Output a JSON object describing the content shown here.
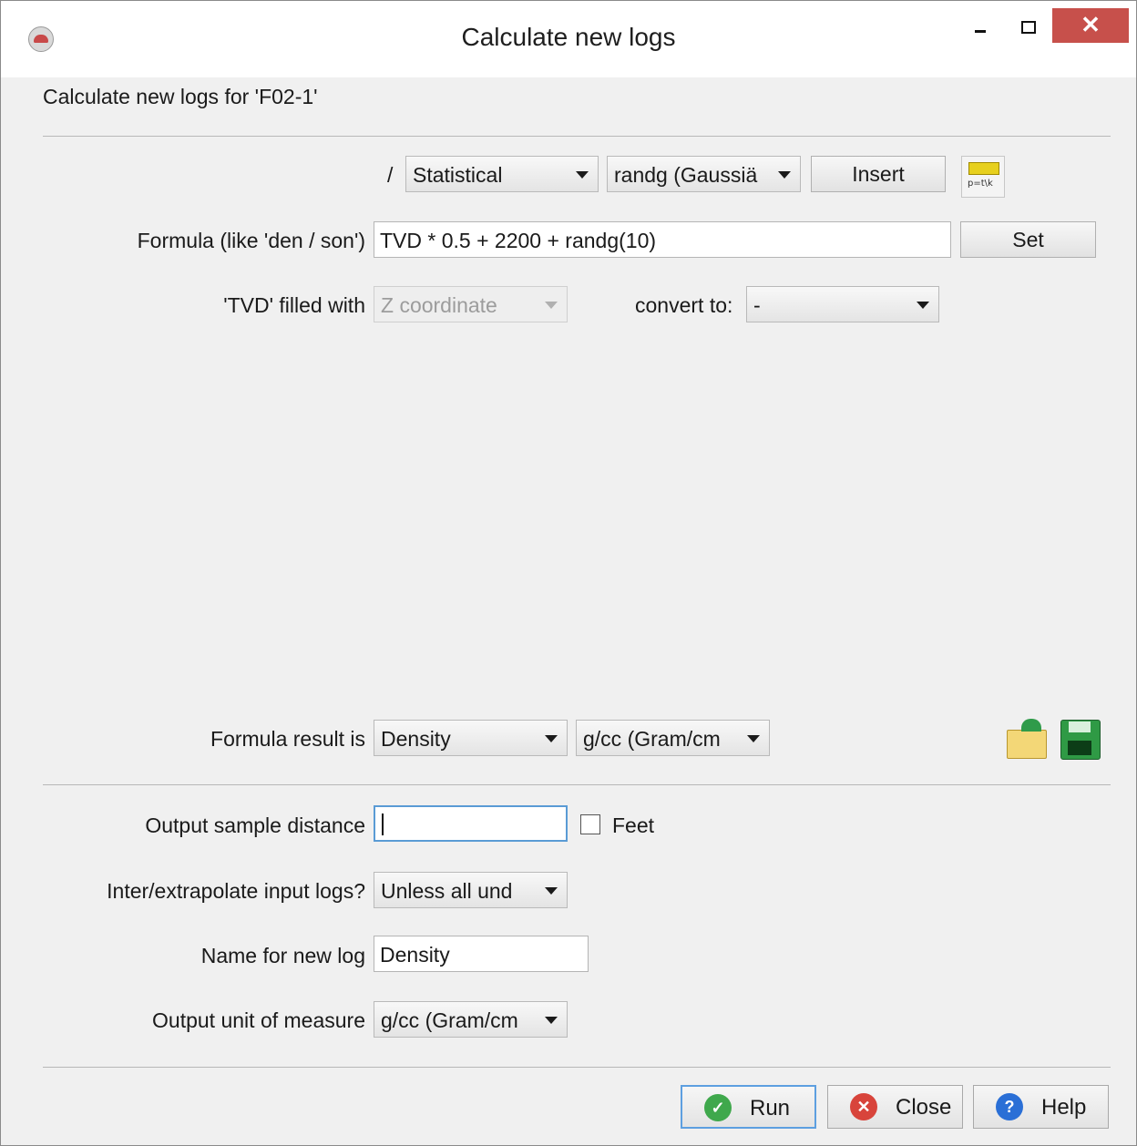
{
  "window": {
    "title": "Calculate new logs"
  },
  "header": {
    "text": "Calculate new logs for 'F02-1'"
  },
  "function_row": {
    "slash": "/",
    "category": "Statistical",
    "function": "randg (Gaussiä",
    "insert_label": "Insert"
  },
  "formula": {
    "label": "Formula (like 'den / son')",
    "value": "TVD * 0.5 + 2200 + randg(10)",
    "set_label": "Set"
  },
  "tvd": {
    "label": "'TVD' filled with",
    "value": "Z coordinate",
    "convert_label": "convert to:",
    "convert_value": "-"
  },
  "result": {
    "label": "Formula result is",
    "type": "Density",
    "unit": "g/cc (Gram/cm"
  },
  "output": {
    "sample_label": "Output sample distance",
    "sample_value": "",
    "feet_label": "Feet",
    "feet_checked": false,
    "interp_label": "Inter/extrapolate input logs?",
    "interp_value": "Unless all und",
    "name_label": "Name for new log",
    "name_value": "Density",
    "unit_label": "Output unit of measure",
    "unit_value": "g/cc (Gram/cm"
  },
  "actions": {
    "run": "Run",
    "close": "Close",
    "help": "Help"
  },
  "colors": {
    "close_button": "#c7504b",
    "focus": "#5a9bd5",
    "run_icon": "#3fa84c",
    "close_icon": "#d8443b",
    "help_icon": "#2a6fd6"
  },
  "icons": [
    "app-icon",
    "formula-icon",
    "open-icon",
    "save-icon",
    "check-icon",
    "x-icon",
    "question-icon"
  ]
}
